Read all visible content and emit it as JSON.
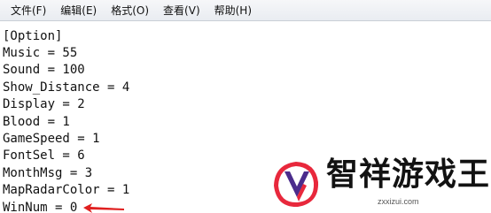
{
  "menu": {
    "items": [
      "文件(F)",
      "编辑(E)",
      "格式(O)",
      "查看(V)",
      "帮助(H)"
    ]
  },
  "editor": {
    "lines": [
      "[Option]",
      "Music = 55",
      "Sound = 100",
      "Show_Distance = 4",
      "Display = 2",
      "Blood = 1",
      "GameSpeed = 1",
      "FontSel = 6",
      "MonthMsg = 3",
      "MapRadarColor = 1",
      "WinNum = 0"
    ]
  },
  "watermark": {
    "title": "智祥游戏王",
    "url": "zxxizui.com"
  },
  "colors": {
    "arrow": "#e02020",
    "logo_red": "#e8283c",
    "logo_purple": "#4b2c8c"
  }
}
